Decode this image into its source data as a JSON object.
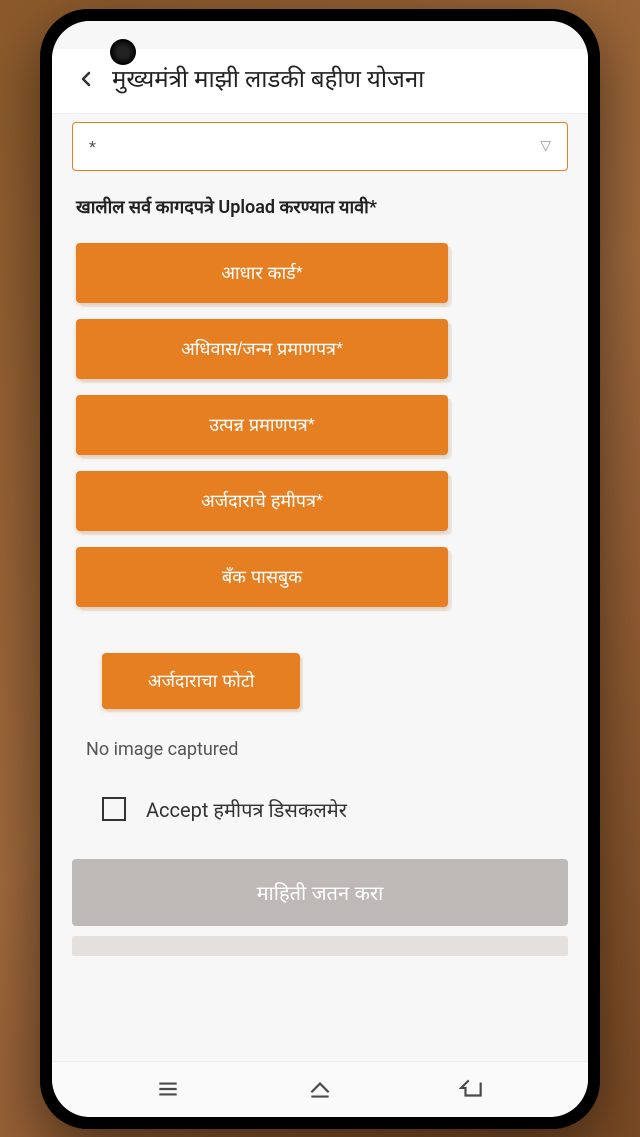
{
  "header": {
    "title": "मुख्यमंत्री माझी लाडकी बहीण योजना"
  },
  "dropdown": {
    "placeholder": "*"
  },
  "section": {
    "upload_label": "खालील सर्व कागदपत्रे Upload करण्यात यावी*"
  },
  "upload_buttons": {
    "aadhar": "आधार कार्ड*",
    "domicile": "अधिवास/जन्म प्रमाणपत्र*",
    "income": "उत्पन्न प्रमाणपत्र*",
    "applicant_bond": "अर्जदाराचे हमीपत्र*",
    "bank": "बँक पासबुक"
  },
  "photo_button": "अर्जदाराचा फोटो",
  "no_image_text": "No image captured",
  "checkbox": {
    "label": "Accept हमीपत्र डिसकलमेर"
  },
  "submit_button": "माहिती जतन करा",
  "colors": {
    "accent": "#e67e22",
    "disabled": "#bdb9b7"
  }
}
